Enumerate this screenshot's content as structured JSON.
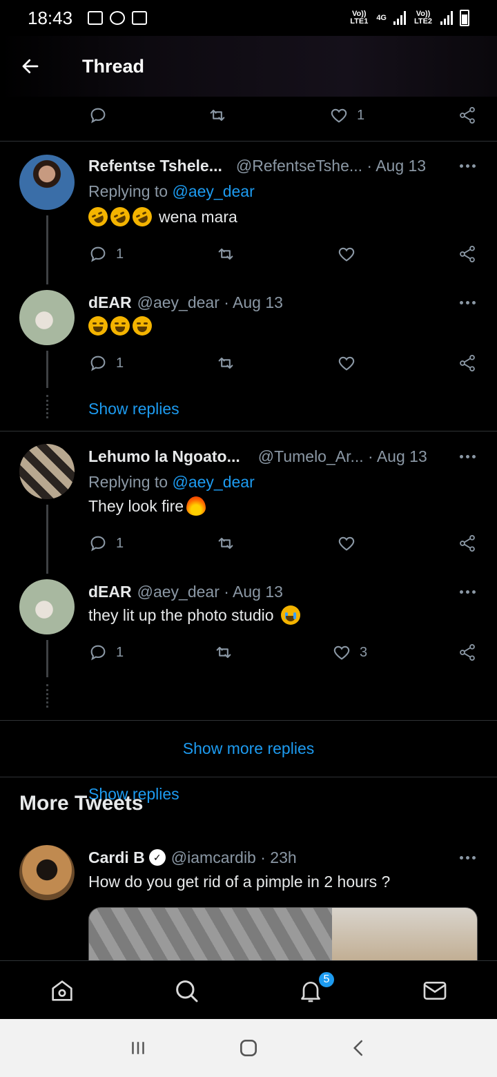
{
  "status_bar": {
    "time": "18:43",
    "sim1": "Vo)) LTE1",
    "network": "4G",
    "sim2": "Vo)) LTE2"
  },
  "header": {
    "title": "Thread"
  },
  "top_actions": {
    "likes": "1"
  },
  "tweets": [
    {
      "name": "Refentse Tshele...",
      "handle": "@RefentseTshe... · Aug 13",
      "replying_prefix": "Replying to ",
      "replying_to": "@aey_dear",
      "text": "wena mara",
      "replies": "1",
      "retweets": "",
      "likes": ""
    },
    {
      "name": "dEAR",
      "handle": "@aey_dear · Aug 13",
      "text": "",
      "replies": "1",
      "retweets": "",
      "likes": "",
      "show_replies": "Show replies"
    },
    {
      "name": "Lehumo la Ngoato...",
      "handle": "@Tumelo_Ar... · Aug 13",
      "replying_prefix": "Replying to ",
      "replying_to": "@aey_dear",
      "text": "They look fire",
      "replies": "1",
      "retweets": "",
      "likes": ""
    },
    {
      "name": "dEAR",
      "handle": "@aey_dear · Aug 13",
      "text": "they lit up the photo studio",
      "replies": "1",
      "retweets": "",
      "likes": "3",
      "show_replies": "Show replies"
    }
  ],
  "show_more_replies": "Show more replies",
  "more_tweets": {
    "title": "More Tweets",
    "tweet": {
      "name": "Cardi B",
      "handle": "@iamcardib · 23h",
      "text": "How do you get rid of a pimple in 2 hours ?"
    }
  },
  "bottom_nav": {
    "items": [
      "home-icon",
      "search-icon",
      "notifications-icon",
      "messages-icon"
    ],
    "notifications_badge": "5"
  },
  "colors": {
    "accent": "#1d9bf0",
    "background": "#000000",
    "secondary_text": "#8b98a5"
  }
}
